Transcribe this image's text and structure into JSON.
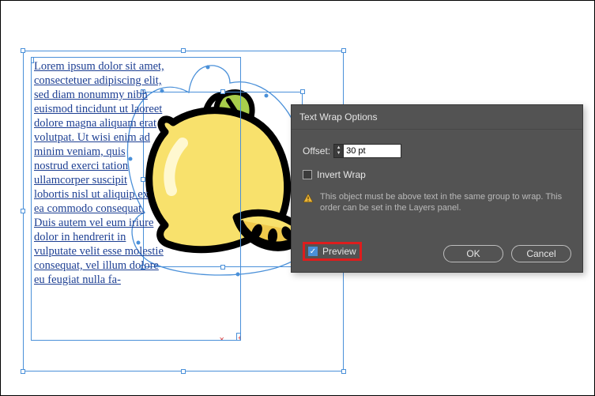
{
  "text_frame": {
    "content": "Lorem ipsum dolor sit amet, consectetuer adipiscing elit, sed diam nonummy nibh euismod tincidunt ut laoreet dolore magna aliquam erat volutpat. Ut wisi enim ad minim veniam, quis nostrud exerci tation ullamcorper suscipit lobortis nisl ut aliquip ex ea commodo consequat. Duis autem vel eum iriure dolor in hendrerit in vulputate velit esse molestie consequat, vel illum dolore eu feugiat nulla fa-"
  },
  "dialog": {
    "title": "Text Wrap Options",
    "offset_label": "Offset:",
    "offset_value": "30 pt",
    "invert_label": "Invert Wrap",
    "invert_checked": false,
    "warning": "This object must be above text in the same group to wrap. This order can be set in the Layers panel.",
    "preview_label": "Preview",
    "preview_checked": true,
    "ok": "OK",
    "cancel": "Cancel"
  }
}
